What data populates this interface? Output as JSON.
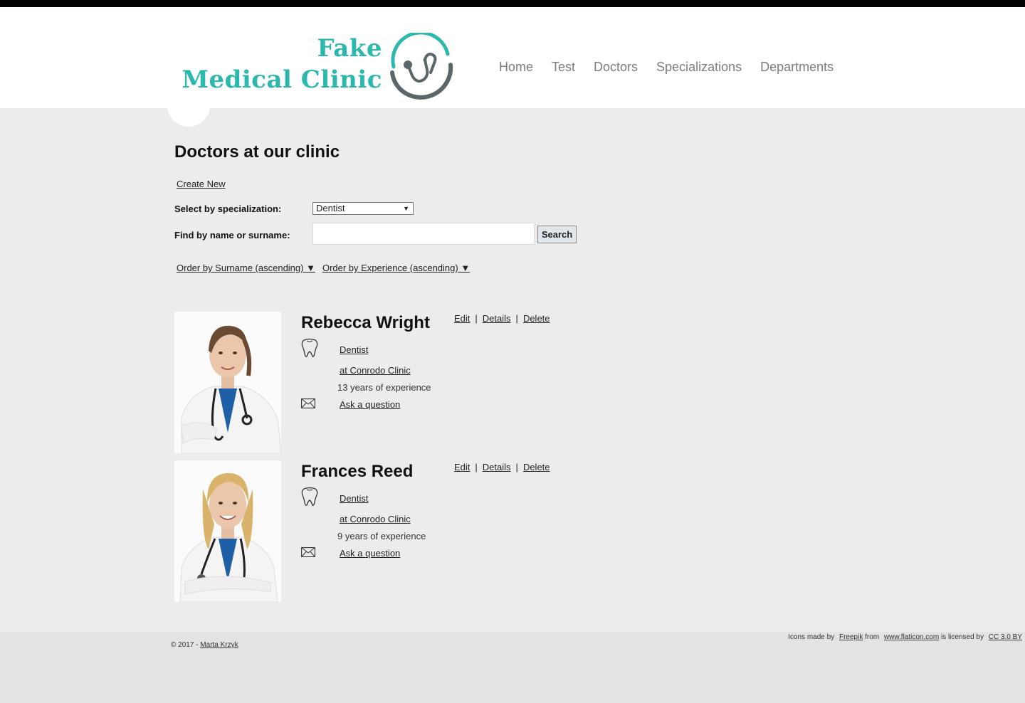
{
  "logo": {
    "line1": "Fake",
    "line2": "Medical Clinic",
    "icon": "stethoscope-icon",
    "brand_color": "#2bb9ad"
  },
  "nav": [
    {
      "label": "Home"
    },
    {
      "label": "Test"
    },
    {
      "label": "Doctors"
    },
    {
      "label": "Specializations"
    },
    {
      "label": "Departments"
    }
  ],
  "page": {
    "title": "Doctors at our clinic",
    "create_new": "Create New"
  },
  "filters": {
    "specialization_label": "Select by specialization:",
    "specialization_value": "Dentist",
    "search_label": "Find by name or surname:",
    "search_value": "",
    "search_button": "Search",
    "order_surname": "Order by Surname (ascending) ▼",
    "order_experience": "Order by Experience (ascending) ▼"
  },
  "doctors": [
    {
      "name": "Rebecca Wright",
      "specialization": "Dentist",
      "clinic": "at Conrodo Clinic",
      "experience": "13 years of experience",
      "ask": "Ask a question",
      "edit": "Edit",
      "details": "Details",
      "delete": "Delete",
      "sep": "|"
    },
    {
      "name": "Frances Reed",
      "specialization": "Dentist",
      "clinic": "at Conrodo Clinic",
      "experience": "9 years of experience",
      "ask": "Ask a question",
      "edit": "Edit",
      "details": "Details",
      "delete": "Delete",
      "sep": "|"
    }
  ],
  "footer": {
    "copyright": "© 2017 -",
    "author": "Marta Krzyk",
    "credits_prefix": "Icons made by",
    "credits_author": "Freepik",
    "credits_from": "from",
    "credits_site": "www.flaticon.com",
    "credits_licensed": "is licensed by",
    "credits_license": "CC 3.0 BY"
  }
}
